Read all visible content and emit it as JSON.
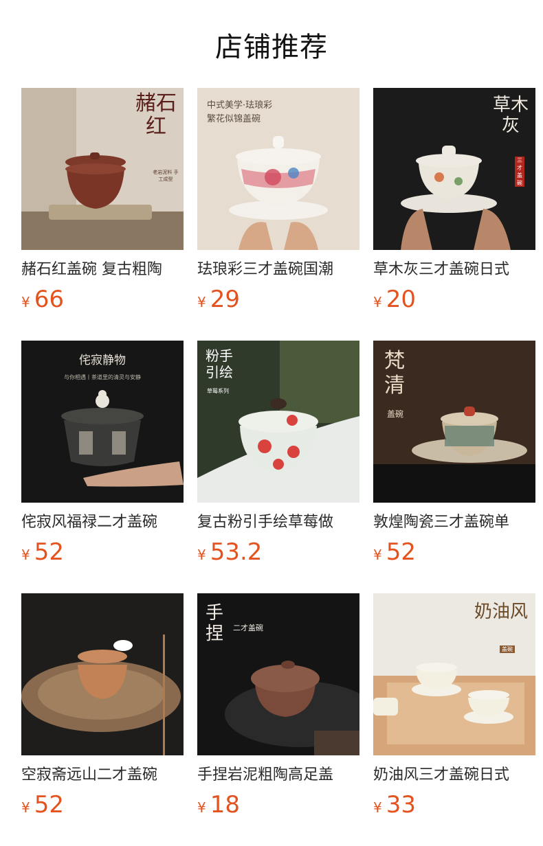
{
  "section": {
    "title": "店铺推荐"
  },
  "products": [
    {
      "name": "赭石红盖碗 复古粗陶",
      "currency": "¥",
      "price": "66",
      "img_text": "赭石红",
      "img_sub": "老岩泥料 手工成型"
    },
    {
      "name": "珐琅彩三才盖碗国潮",
      "currency": "¥",
      "price": "29",
      "img_text": "中式美学·珐琅彩",
      "img_sub": "繁花似锦盖碗"
    },
    {
      "name": "草木灰三才盖碗日式",
      "currency": "¥",
      "price": "20",
      "img_text": "草木灰",
      "img_sub": "三才盖碗"
    },
    {
      "name": "侘寂风福禄二才盖碗",
      "currency": "¥",
      "price": "52",
      "img_text": "侘寂静物",
      "img_sub": "与你相遇丨茶道里的清灵与安静"
    },
    {
      "name": "复古粉引手绘草莓做",
      "currency": "¥",
      "price": "53.2",
      "img_text": "粉手引绘",
      "img_sub": "草莓系列"
    },
    {
      "name": "敦煌陶瓷三才盖碗单",
      "currency": "¥",
      "price": "52",
      "img_text": "梵清",
      "img_sub": "盖碗"
    },
    {
      "name": "空寂斋远山二才盖碗",
      "currency": "¥",
      "price": "52",
      "img_text": "",
      "img_sub": ""
    },
    {
      "name": "手捏岩泥粗陶高足盖",
      "currency": "¥",
      "price": "18",
      "img_text": "手捏",
      "img_sub": "二才盖碗"
    },
    {
      "name": "奶油风三才盖碗日式",
      "currency": "¥",
      "price": "33",
      "img_text": "奶油风",
      "img_sub": "盖碗"
    }
  ],
  "colors": {
    "price": "#e4531f",
    "title": "#111111",
    "name": "#2a2a2a"
  }
}
